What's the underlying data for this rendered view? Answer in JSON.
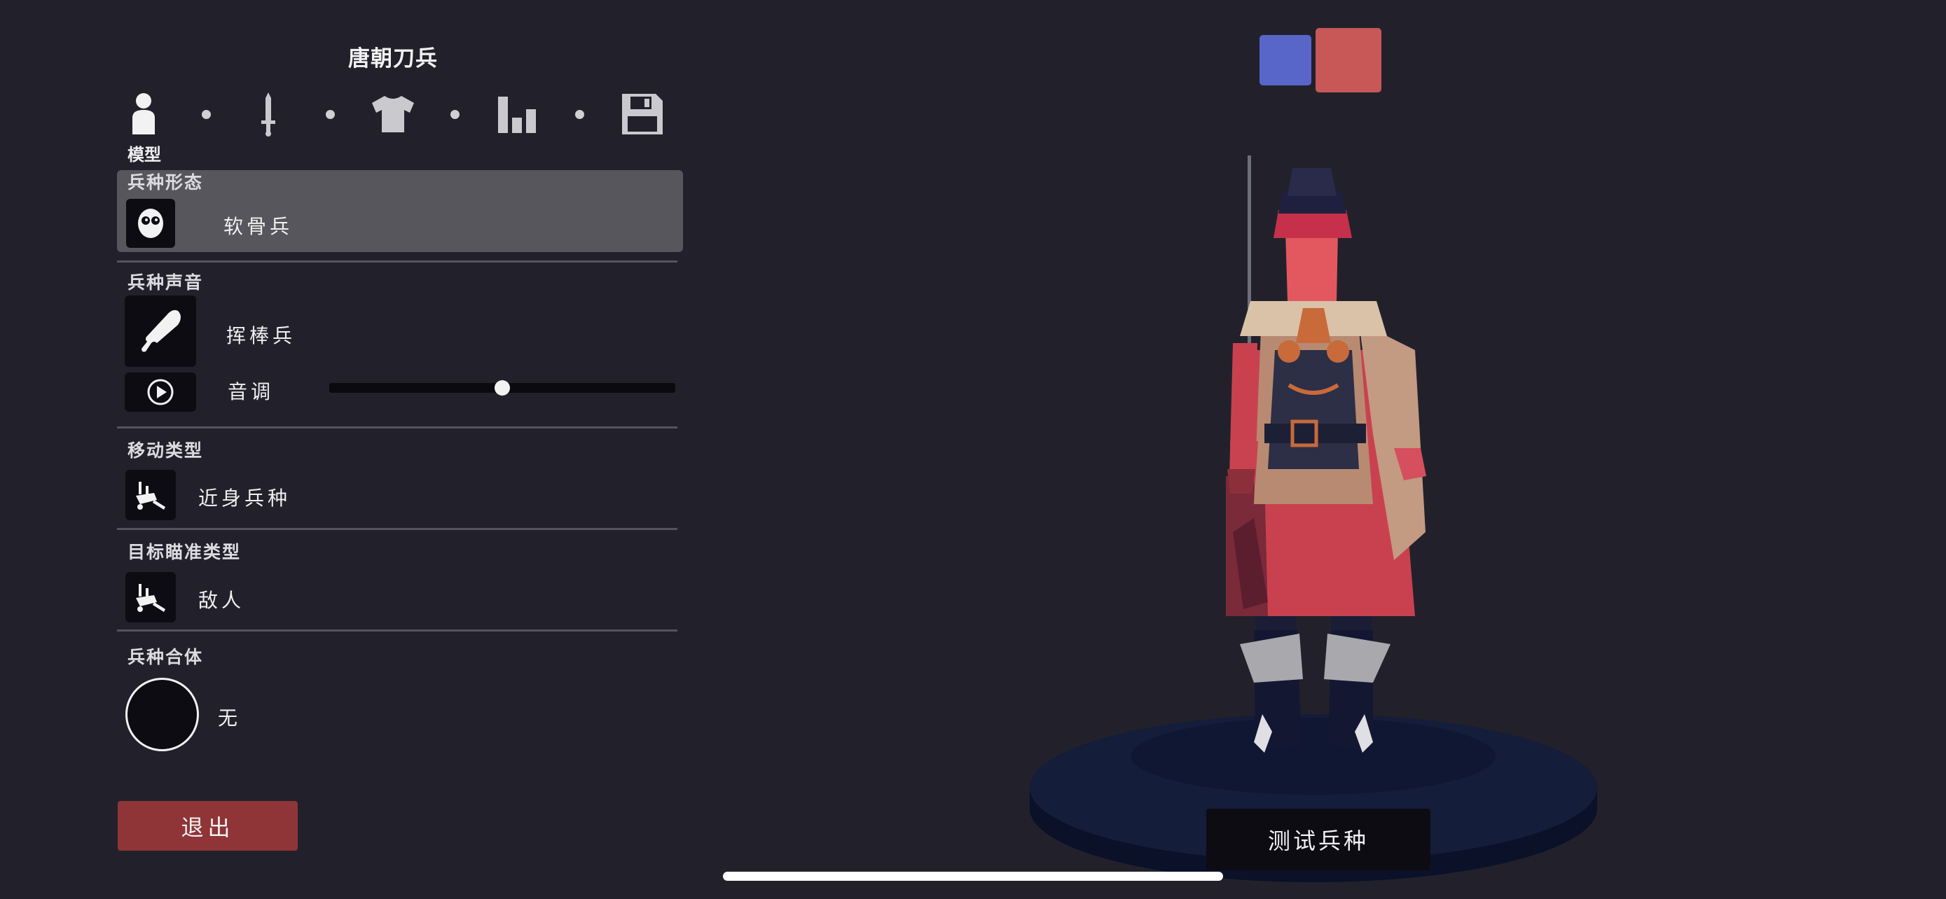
{
  "header": {
    "unit_name": "唐朝刀兵"
  },
  "tabs": [
    {
      "icon": "person-icon",
      "label": "模型",
      "active": true
    },
    {
      "icon": "sword-icon",
      "active": false
    },
    {
      "icon": "shirt-icon",
      "active": false
    },
    {
      "icon": "bar-stats-icon",
      "active": false
    },
    {
      "icon": "save-disk-icon",
      "active": false
    }
  ],
  "sections": {
    "form": {
      "label": "兵种形态",
      "value": "软骨兵",
      "icon": "ragdoll-face-icon"
    },
    "voice": {
      "label": "兵种声音",
      "value": "挥棒兵",
      "icon": "drumstick-icon",
      "play_icon": "play-icon",
      "pitch_label": "音调",
      "pitch_value": 0.5
    },
    "movement": {
      "label": "移动类型",
      "value": "近身兵种",
      "icon": "melee-unit-icon"
    },
    "targeting": {
      "label": "目标瞄准类型",
      "value": "敌人",
      "icon": "target-enemy-icon"
    },
    "merge": {
      "label": "兵种合体",
      "value": "无",
      "icon": "empty-circle-icon"
    }
  },
  "buttons": {
    "exit": "退出",
    "test_unit": "测试兵种"
  },
  "team_colors": {
    "blue": "#5766c8",
    "red": "#c85757",
    "selected": "red"
  }
}
